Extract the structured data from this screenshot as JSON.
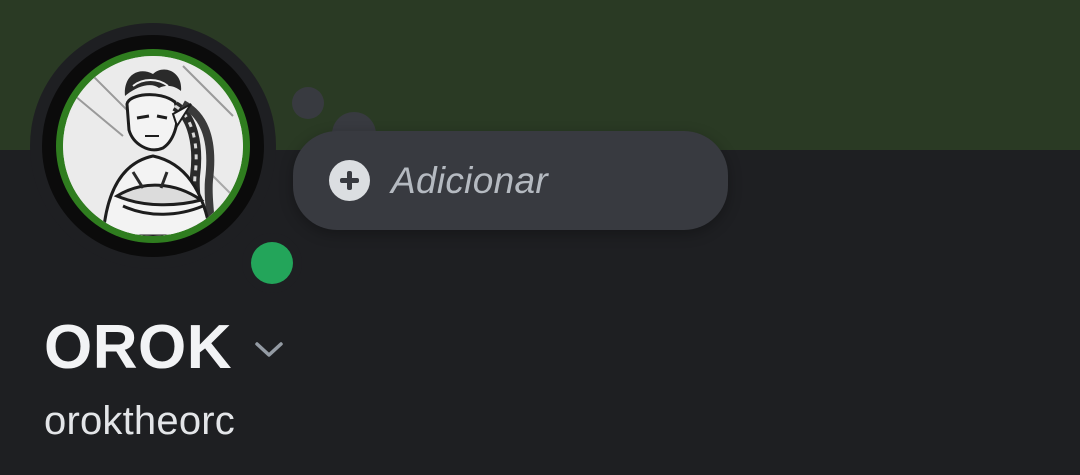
{
  "profile": {
    "display_name": "OROK",
    "username": "oroktheorc",
    "status_online": true
  },
  "custom_status": {
    "add_label": "Adicionar",
    "icon": "plus-circle-icon"
  },
  "icons": {
    "name_menu": "chevron-down-icon"
  },
  "colors": {
    "banner": "#2a3a24",
    "background": "#1e1f22",
    "pill": "#383a40",
    "online": "#23a55a",
    "avatar_ring": "#2f7d1f"
  }
}
